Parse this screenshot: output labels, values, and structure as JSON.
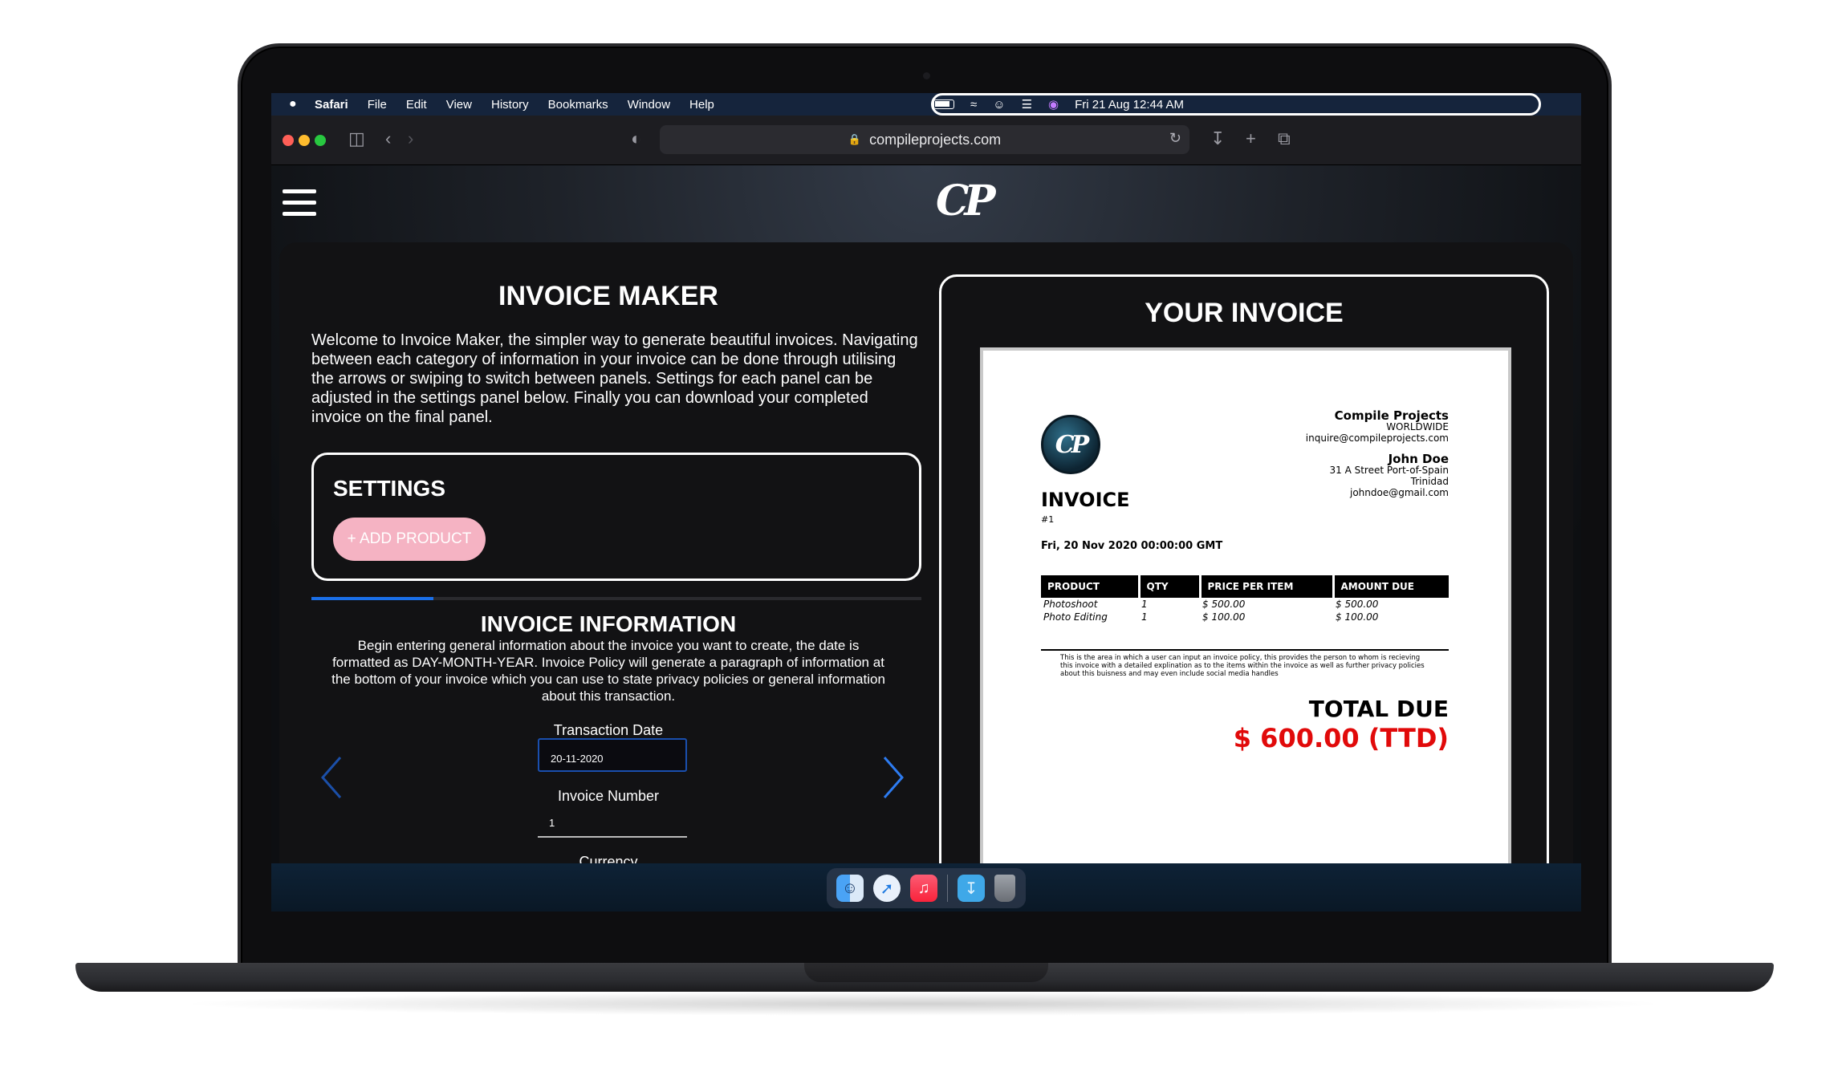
{
  "menubar": {
    "apple": "",
    "items": [
      "Safari",
      "File",
      "Edit",
      "View",
      "History",
      "Bookmarks",
      "Window",
      "Help"
    ],
    "datetime": "Fri 21 Aug  12:44 AM"
  },
  "browser": {
    "url": "compileprojects.com",
    "traffic_colors": [
      "#ff5f57",
      "#febc2e",
      "#28c840"
    ]
  },
  "site": {
    "logo_text": "CP"
  },
  "maker": {
    "title": "INVOICE MAKER",
    "intro": "Welcome to Invoice Maker, the simpler way to generate beautiful invoices. Navigating between each category of information in your invoice can be done through utilising the arrows or swiping to switch between panels. Settings for each panel can be adjusted in the settings panel below. Finally you can download your completed invoice on the final panel.",
    "settings_title": "SETTINGS",
    "add_product": "+ ADD PRODUCT",
    "progress": 0.2,
    "info_title": "INVOICE INFORMATION",
    "info_desc": "Begin entering general information about the invoice you want to create, the date is formatted as DAY-MONTH-YEAR. Invoice Policy will generate a paragraph of information at the bottom of your invoice which you can use to state privacy policies or general information about this transaction.",
    "date_label": "Transaction Date",
    "date_value": "20-11-2020",
    "number_label": "Invoice Number",
    "number_value": "1",
    "currency_label": "Currency"
  },
  "preview": {
    "title": "YOUR INVOICE",
    "company_name": "Compile Projects",
    "company_region": "WORLDWIDE",
    "company_email": "inquire@compileprojects.com",
    "client_name": "John Doe",
    "client_street": "31 A Street Port-of-Spain",
    "client_country": "Trinidad",
    "client_email": "johndoe@gmail.com",
    "invoice_label": "INVOICE",
    "invoice_number": "#1",
    "invoice_date": "Fri, 20 Nov 2020 00:00:00 GMT",
    "columns": [
      "PRODUCT",
      "QTY",
      "PRICE PER ITEM",
      "AMOUNT DUE"
    ],
    "rows": [
      [
        "Photoshoot",
        "1",
        "$ 500.00",
        "$ 500.00"
      ],
      [
        "Photo Editing",
        "1",
        "$ 100.00",
        "$ 100.00"
      ]
    ],
    "policy": "This is the area in which a user can input an invoice policy, this provides the person to whom is recieving this invoice with a detailed explination as to the items within the invoice as well as further privacy policies about this buisness and may even include social media handles",
    "total_label": "TOTAL DUE",
    "total_value": "$ 600.00 (TTD)"
  },
  "dock": {
    "icons": [
      "finder-icon",
      "safari-icon",
      "music-icon",
      "downloads-folder-icon",
      "trash-icon"
    ]
  }
}
